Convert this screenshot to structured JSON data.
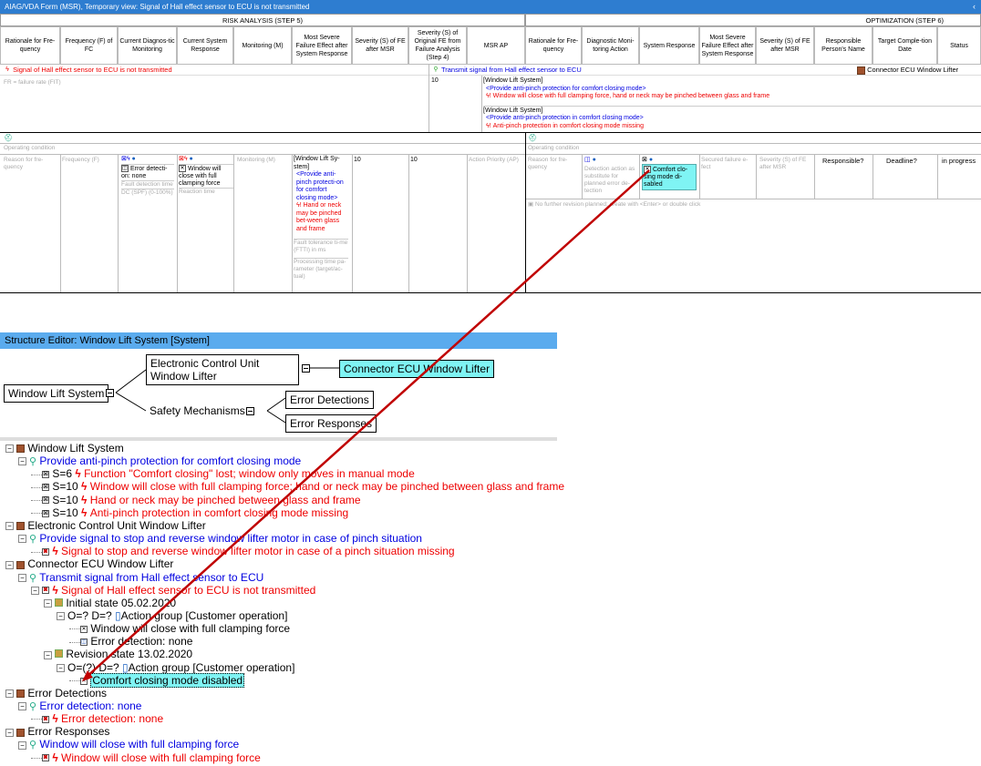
{
  "window_title": "AIAG/VDA Form (MSR), Temporary view: Signal of Hall effect sensor to ECU is not transmitted",
  "title_arrow": "‹",
  "risk_section": "RISK ANALYSIS (STEP 5)",
  "opt_section": "OPTIMIZATION  (STEP 6)",
  "headers_risk": [
    "Rationale for Fre-quency",
    "Frequency (F) of FC",
    "Current Diagnos-tic Monitoring",
    "Current System Response",
    "Monitoring (M)",
    "Most Severe Failure Effect after System Response",
    "Severity (S) of FE after MSR",
    "Severity (S) of Original FE from Failure Analysis (Step 4)",
    "MSR AP"
  ],
  "headers_opt": [
    "Rationale for Fre-quency",
    "Diagnostic Moni-toring Action",
    "System Response",
    "Most Severe Failure Effect after System Response",
    "Severity (S) of FE after MSR",
    "Responsible Person's Name",
    "Target Comple-tion Date",
    "Status"
  ],
  "row1": {
    "failure": "Signal of Hall effect sensor to ECU is not transmitted",
    "function": "Transmit signal from Hall effect sensor to ECU",
    "element": "Connector ECU Window Lifter",
    "fit": "FR = failure rate (FIT)",
    "severity": "10",
    "fe1_sys": "[Window Lift System]",
    "fe1_func": "<Provide anti-pinch protection for comfort closing mode>",
    "fe1_eff": "Window will close with full clamping force, hand or neck may be pinched between glass and frame",
    "fe2_sys": "[Window Lift System]",
    "fe2_func": "<Provide anti-pinch protection in comfort closing mode>",
    "fe2_eff": "Anti-pinch protection in comfort closing mode missing"
  },
  "row2": {
    "op_cond": "Operating condition",
    "reason_ph": "Reason for fre-quency",
    "freq_ph": "Frequency (F)",
    "diag": "Error detecti-on: none",
    "fault_det": "Fault detection time",
    "dc": "DC (SPF) (0-100%)",
    "resp": "Window will close with full clamping force",
    "reaction": "Reaction time",
    "monitor_ph": "Monitoring (M)",
    "fe_sys": "[Window Lift Sy-stem]",
    "fe_func": "<Provide anti-pinch protecti-on for comfort closing mode>",
    "fe_eff": "Hand or neck may be pinched bet-ween glass and frame",
    "ftti": "Fault tolerance ti-me (FTTI) in ms",
    "proc_time": "Processing time pa-rameter (target/ac-tual)",
    "s_after": "10",
    "s_orig": "10",
    "ap_ph": "Action Priority (AP)"
  },
  "row2_opt": {
    "op_cond": "Operating condition",
    "reason_ph": "Reason for fre-quency",
    "det_ph": "Detection action as substitute for planned error de-tection",
    "sys_resp": "Comfort clo-sing mode di-sabled",
    "secured_ph": "Secured failure e-fect",
    "sev_ph": "Severity (S) of FE after MSR",
    "responsible": "Responsible?",
    "deadline": "Deadline?",
    "status": "in progress",
    "no_rev": "No further revision planned; create with <Enter> or double click"
  },
  "structure_editor": {
    "title": "Structure Editor: Window Lift System [System]",
    "root": "Window Lift System",
    "ecu": "Electronic Control Unit Window Lifter",
    "connector": "Connector ECU Window Lifter",
    "safety": "Safety Mechanisms",
    "err_det": "Error Detections",
    "err_resp": "Error Responses"
  },
  "tree": [
    {
      "indent": 0,
      "icon": "comp",
      "text": "Window Lift System",
      "color": "#000"
    },
    {
      "indent": 1,
      "icon": "func",
      "text": "Provide anti-pinch protection for comfort closing mode",
      "color": "#0000e0"
    },
    {
      "indent": 2,
      "icon": "fe",
      "prefix": "S=6",
      "text": "Function \"Comfort closing\" lost; window only moves in manual mode",
      "color": "#e00"
    },
    {
      "indent": 2,
      "icon": "fe",
      "prefix": "S=10",
      "text": "Window will close with full clamping force; hand or neck may be pinched between glass and frame",
      "color": "#e00"
    },
    {
      "indent": 2,
      "icon": "fe",
      "prefix": "S=10",
      "text": "Hand or neck may be pinched between glass and frame",
      "color": "#e00"
    },
    {
      "indent": 2,
      "icon": "fe",
      "prefix": "S=10",
      "text": "Anti-pinch protection in comfort closing mode missing",
      "color": "#e00"
    },
    {
      "indent": 0,
      "icon": "comp",
      "text": "Electronic Control Unit Window Lifter",
      "color": "#000"
    },
    {
      "indent": 1,
      "icon": "func",
      "text": "Provide signal to stop and reverse window lifter motor in case of pinch situation",
      "color": "#0000e0"
    },
    {
      "indent": 2,
      "icon": "fm",
      "text": "Signal to stop and reverse window lifter motor in case of a pinch situation missing",
      "color": "#e00"
    },
    {
      "indent": 0,
      "icon": "comp",
      "text": "Connector ECU Window Lifter",
      "color": "#000"
    },
    {
      "indent": 1,
      "icon": "func",
      "text": "Transmit signal from Hall effect sensor to ECU",
      "color": "#0000e0"
    },
    {
      "indent": 2,
      "icon": "fm",
      "text": "Signal of Hall effect sensor to ECU is not transmitted",
      "color": "#e00"
    },
    {
      "indent": 3,
      "icon": "state",
      "text": "Initial state 05.02.2020",
      "color": "#000"
    },
    {
      "indent": 4,
      "icon": "none",
      "text": "O=? D=? ",
      "suffix": "Action group [Customer operation]",
      "color": "#000"
    },
    {
      "indent": 5,
      "icon": "resp",
      "text": "Window will close with full clamping force",
      "color": "#000"
    },
    {
      "indent": 5,
      "icon": "det",
      "text": "Error detection: none",
      "color": "#000"
    },
    {
      "indent": 3,
      "icon": "state",
      "text": "Revision state 13.02.2020",
      "color": "#000"
    },
    {
      "indent": 4,
      "icon": "none",
      "text": "O=(?) D=? ",
      "suffix": "Action group [Customer operation]",
      "color": "#000"
    },
    {
      "indent": 5,
      "icon": "resp",
      "text": "Comfort closing mode disabled",
      "color": "#000",
      "selected": true
    },
    {
      "indent": 0,
      "icon": "comp",
      "text": "Error Detections",
      "color": "#000"
    },
    {
      "indent": 1,
      "icon": "func2",
      "text": "Error detection: none",
      "color": "#0000e0"
    },
    {
      "indent": 2,
      "icon": "fm",
      "text": "Error detection: none",
      "color": "#e00"
    },
    {
      "indent": 0,
      "icon": "comp",
      "text": "Error Responses",
      "color": "#000"
    },
    {
      "indent": 1,
      "icon": "func2",
      "text": "Window will close with full clamping force",
      "color": "#0000e0"
    },
    {
      "indent": 2,
      "icon": "fm",
      "text": "Window will close with full clamping force",
      "color": "#e00"
    }
  ]
}
